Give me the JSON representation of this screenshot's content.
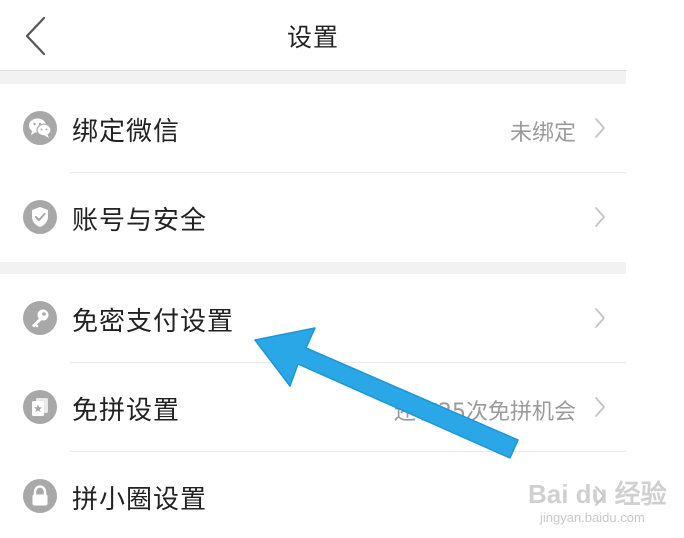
{
  "header": {
    "title": "设置",
    "back_icon": "chevron-left-icon"
  },
  "rows": [
    {
      "label": "绑定微信",
      "value": "未绑定",
      "icon": "wechat-icon"
    },
    {
      "label": "账号与安全",
      "value": "",
      "icon": "shield-check-icon"
    },
    {
      "label": "免密支付设置",
      "value": "",
      "icon": "key-icon"
    },
    {
      "label": "免拼设置",
      "value": "还有25次免拼机会",
      "icon": "card-star-icon"
    },
    {
      "label": "拼小圈设置",
      "value": "",
      "icon": "lock-icon"
    }
  ],
  "annotation": {
    "arrow_color": "#29a8e8",
    "points_to": "免密支付设置"
  },
  "watermark": {
    "main": "Bai du 经验",
    "sub": "jingyan.baidu.com"
  },
  "colors": {
    "icon_bg": "#a8a8a8",
    "separator": "#f2f2f2",
    "secondary_text": "#9a9a9a"
  }
}
